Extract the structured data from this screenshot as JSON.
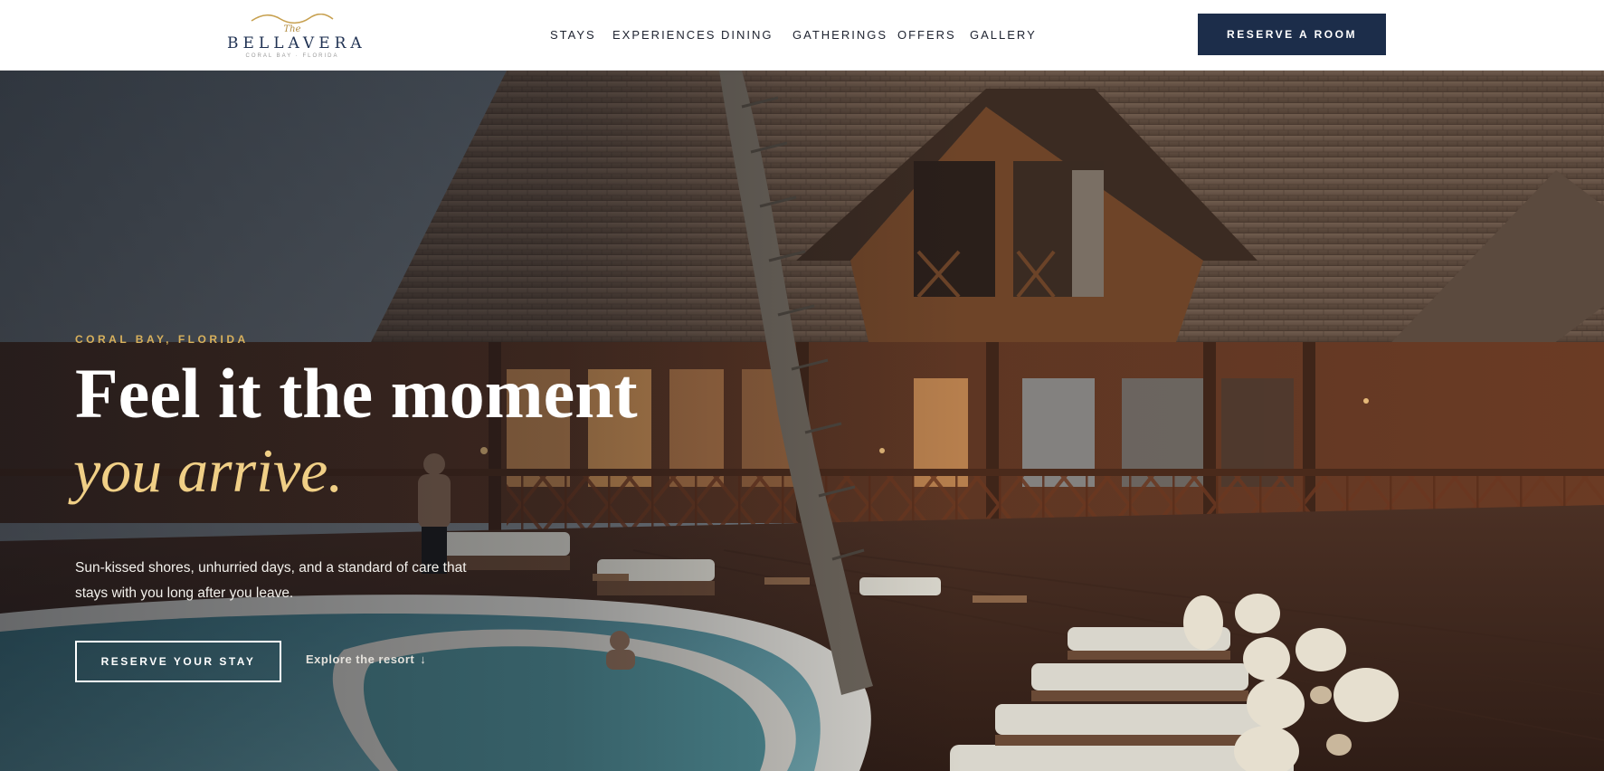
{
  "brand": {
    "the": "The",
    "name": "BELLAVERA",
    "location_small": "CORAL BAY · FLORIDA",
    "colors": {
      "navy": "#1c2d4a",
      "gold": "#d9b15c"
    }
  },
  "nav": {
    "items": [
      {
        "label": "STAYS"
      },
      {
        "label": "EXPERIENCES"
      },
      {
        "label": "DINING"
      },
      {
        "label": "GATHERINGS"
      },
      {
        "label": "OFFERS"
      },
      {
        "label": "GALLERY"
      }
    ],
    "cta_label": "RESERVE A ROOM"
  },
  "hero": {
    "eyebrow": "CORAL BAY, FLORIDA",
    "headline_line1": "Feel it the moment",
    "headline_line2": "you arrive.",
    "description": "Sun-kissed shores, unhurried days, and a standard of care that stays with you long after you leave.",
    "primary_cta": "RESERVE YOUR STAY",
    "secondary_cta": "Explore the resort",
    "secondary_icon": "arrow-down-icon",
    "image_alt": "resort-pool-photo"
  }
}
